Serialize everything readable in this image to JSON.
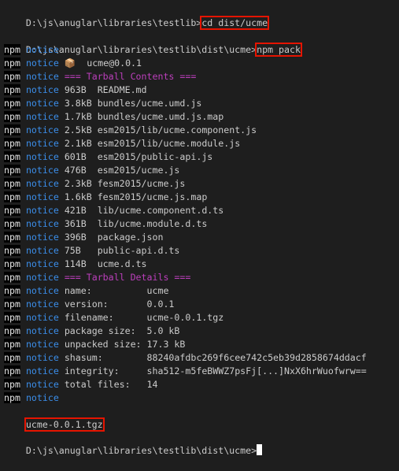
{
  "prompt1": {
    "path": "D:\\js\\anuglar\\libraries\\testlib>",
    "cmd": "cd dist/ucme"
  },
  "prompt2": {
    "path": "D:\\js\\anuglar\\libraries\\testlib\\dist\\ucme>",
    "cmd": "npm pack"
  },
  "npm_label": "npm",
  "notice_label": "notice",
  "notice_lines": [
    "",
    "📦  ucme@0.0.1",
    "=== Tarball Contents ===",
    "963B  README.md",
    "3.8kB bundles/ucme.umd.js",
    "1.7kB bundles/ucme.umd.js.map",
    "2.5kB esm2015/lib/ucme.component.js",
    "2.1kB esm2015/lib/ucme.module.js",
    "601B  esm2015/public-api.js",
    "476B  esm2015/ucme.js",
    "2.3kB fesm2015/ucme.js",
    "1.6kB fesm2015/ucme.js.map",
    "421B  lib/ucme.component.d.ts",
    "361B  lib/ucme.module.d.ts",
    "396B  package.json",
    "75B   public-api.d.ts",
    "114B  ucme.d.ts",
    "=== Tarball Details ===",
    "name:          ucme",
    "version:       0.0.1",
    "filename:      ucme-0.0.1.tgz",
    "package size:  5.0 kB",
    "unpacked size: 17.3 kB",
    "shasum:        88240afdbc269f6cee742c5eb39d2858674ddacf",
    "integrity:     sha512-m5feBWWZ7psFj[...]NxX6hrWuofwrw==",
    "total files:   14",
    ""
  ],
  "output_file": "ucme-0.0.1.tgz",
  "prompt3": {
    "path": "D:\\js\\anuglar\\libraries\\testlib\\dist\\ucme>"
  },
  "colors": {
    "background": "#1e1e1e",
    "notice": "#3b8eea",
    "heading": "#bc3fbc",
    "highlight_box": "#e51400"
  }
}
